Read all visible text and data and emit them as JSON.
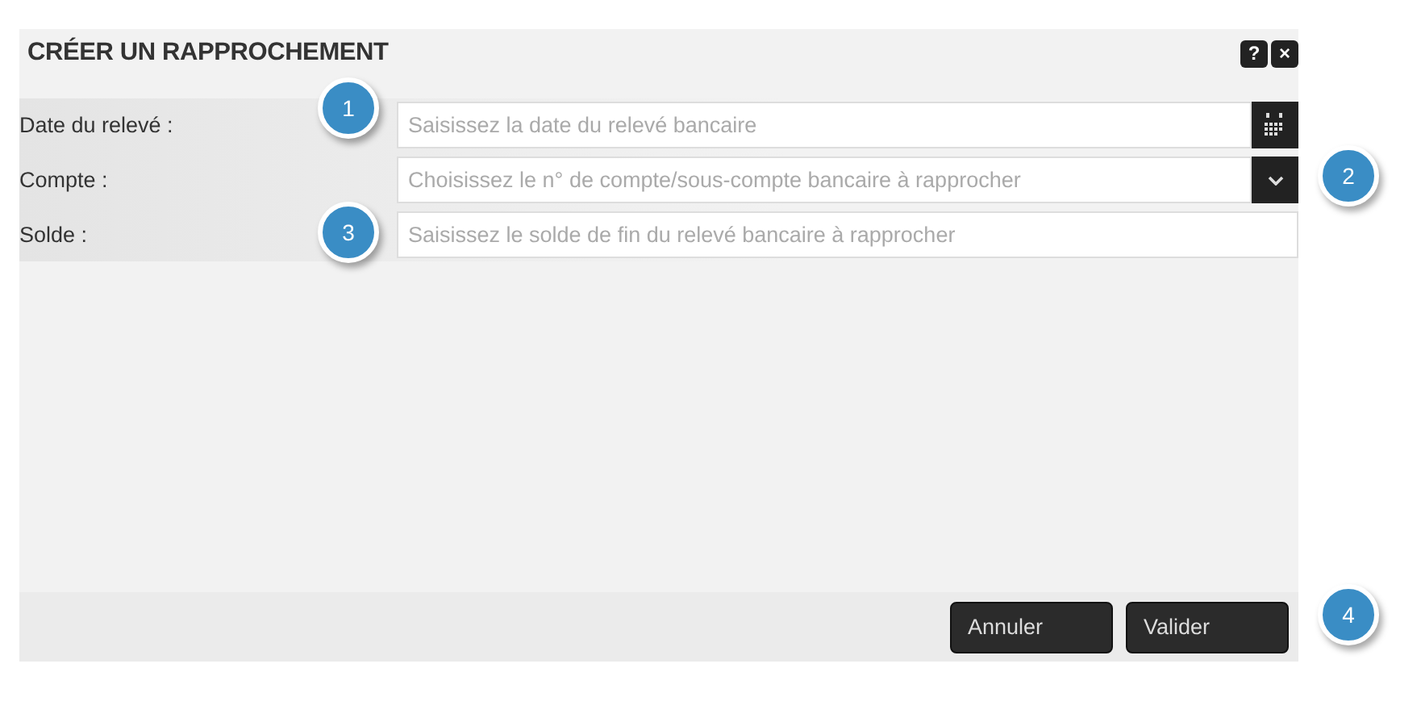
{
  "dialog": {
    "title": "CRÉER UN RAPPROCHEMENT",
    "header_buttons": [
      "?",
      "×"
    ]
  },
  "fields": [
    {
      "label": "Date du relevé :",
      "kind": "date",
      "placeholder": "Saisissez la date du relevé bancaire"
    },
    {
      "label": "Compte :",
      "kind": "select",
      "placeholder": "Choisissez le n° de compte/sous-compte bancaire à rapprocher"
    },
    {
      "label": "Solde :",
      "kind": "text",
      "placeholder": "Saisissez le solde de fin du relevé bancaire à rapprocher"
    }
  ],
  "buttons": [
    "Annuler",
    "Valider"
  ],
  "callouts": [
    "1",
    "2",
    "3",
    "4"
  ]
}
